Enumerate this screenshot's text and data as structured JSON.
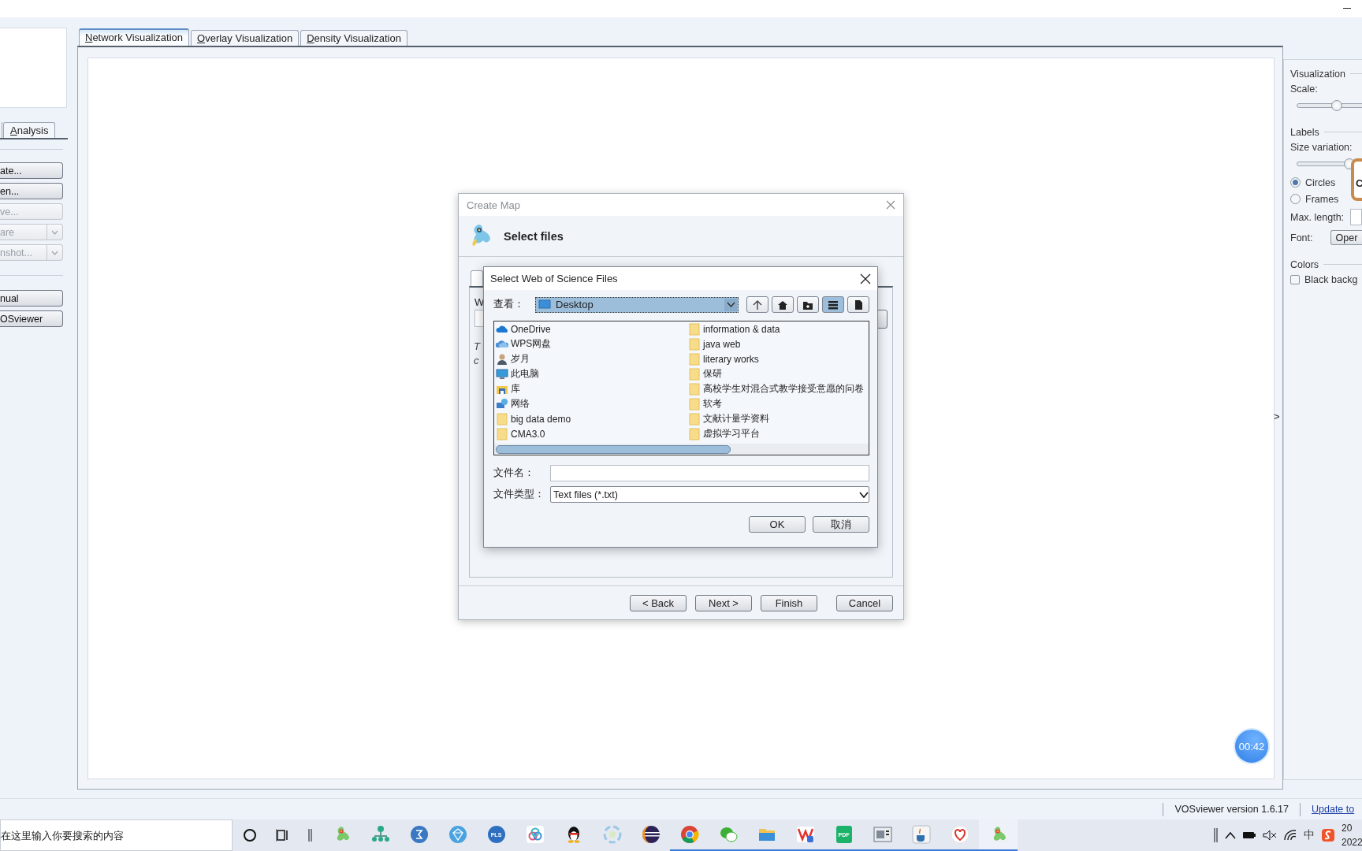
{
  "left_panel": {
    "tabs": [
      {
        "label": "Analysis",
        "selected": false
      }
    ],
    "action_buttons": [
      {
        "label": "ate...",
        "disabled": false,
        "dropdown": false
      },
      {
        "label": "en...",
        "disabled": false,
        "dropdown": false
      },
      {
        "label": "ve...",
        "disabled": true,
        "dropdown": false
      },
      {
        "label": "are",
        "disabled": true,
        "dropdown": true
      },
      {
        "label": "nshot...",
        "disabled": true,
        "dropdown": true
      }
    ],
    "info_buttons": [
      {
        "label": "nual",
        "disabled": false
      },
      {
        "label": "OSviewer",
        "disabled": false
      }
    ]
  },
  "view_tabs": [
    {
      "label": "Network Visualization",
      "selected": true
    },
    {
      "label": "Overlay Visualization",
      "selected": false
    },
    {
      "label": "Density Visualization",
      "selected": false
    }
  ],
  "expand_arrow": ">",
  "right_panel": {
    "visualization": {
      "title": "Visualization",
      "scale_label": "Scale:",
      "scale": {
        "level": 0.45
      }
    },
    "labels": {
      "title": "Labels",
      "size_variation_label": "Size variation:",
      "size_variation": {
        "level": 0.6
      },
      "shapes": [
        {
          "label": "Circles",
          "selected": true
        },
        {
          "label": "Frames",
          "selected": false
        }
      ],
      "max_length_label": "Max. length:",
      "font_label": "Font:",
      "font_button": "Oper"
    },
    "colors": {
      "title": "Colors",
      "black_background": {
        "label": "Black backg",
        "checked": false
      }
    },
    "popup": {
      "text": "C"
    }
  },
  "timer": "00:42",
  "status_bar": {
    "version": "VOSviewer version 1.6.17",
    "update_link": "Update to"
  },
  "create_map": {
    "title": "Create Map",
    "header": "Select files",
    "label_fragment": "W",
    "note_fragments": [
      "T",
      "c"
    ],
    "buttons": [
      "< Back",
      "Next >",
      "Finish",
      "Cancel"
    ]
  },
  "file_dialog": {
    "title": "Select Web of Science Files",
    "look_in_label": "查看：",
    "look_in": "Desktop",
    "toolbar": [
      {
        "kind": "up",
        "selected": false
      },
      {
        "kind": "home",
        "selected": false
      },
      {
        "kind": "new-folder",
        "selected": false
      },
      {
        "kind": "list",
        "selected": true
      },
      {
        "kind": "details",
        "selected": false
      }
    ],
    "files": [
      {
        "name": "OneDrive",
        "kind": "onedrive"
      },
      {
        "name": "WPS网盘",
        "kind": "wps"
      },
      {
        "name": "岁月",
        "kind": "user"
      },
      {
        "name": "此电脑",
        "kind": "computer"
      },
      {
        "name": "库",
        "kind": "library"
      },
      {
        "name": "网络",
        "kind": "network"
      },
      {
        "name": "big data demo",
        "kind": "folder"
      },
      {
        "name": "CMA3.0",
        "kind": "folder"
      },
      {
        "name": "information & data",
        "kind": "folder"
      },
      {
        "name": "java web",
        "kind": "folder"
      },
      {
        "name": "literary works",
        "kind": "folder"
      },
      {
        "name": "保研",
        "kind": "folder"
      },
      {
        "name": "高校学生对混合式教学接受意愿的问卷",
        "kind": "folder"
      },
      {
        "name": "软考",
        "kind": "folder"
      },
      {
        "name": "文献计量学资料",
        "kind": "folder"
      },
      {
        "name": "虚拟学习平台",
        "kind": "folder"
      }
    ],
    "file_name_label": "文件名：",
    "file_type_label": "文件类型：",
    "file_type": "Text files (*.txt)",
    "buttons": [
      "OK",
      "取消"
    ]
  },
  "taskbar": {
    "search_placeholder": "在这里输入你要搜索的内容",
    "apps": [
      {
        "kind": "vos",
        "running": false
      },
      {
        "kind": "tree",
        "running": false
      },
      {
        "kind": "sigma",
        "running": false
      },
      {
        "kind": "diamond",
        "running": false
      },
      {
        "kind": "pls",
        "label": "PLS",
        "running": false
      },
      {
        "kind": "cloud",
        "running": false
      },
      {
        "kind": "penguin",
        "running": false
      },
      {
        "kind": "swirl",
        "running": false
      },
      {
        "kind": "eclipse",
        "running": false
      },
      {
        "kind": "chrome",
        "running": true
      },
      {
        "kind": "chat",
        "running": true
      },
      {
        "kind": "folder",
        "running": true
      },
      {
        "kind": "wps",
        "running": true
      },
      {
        "kind": "pdf",
        "label": "PDF",
        "running": true
      },
      {
        "kind": "reader",
        "running": true
      },
      {
        "kind": "java",
        "running": true
      },
      {
        "kind": "heart",
        "running": true
      },
      {
        "kind": "vos",
        "running": true
      }
    ],
    "ime": "中",
    "clock": [
      "20",
      "2022"
    ]
  }
}
